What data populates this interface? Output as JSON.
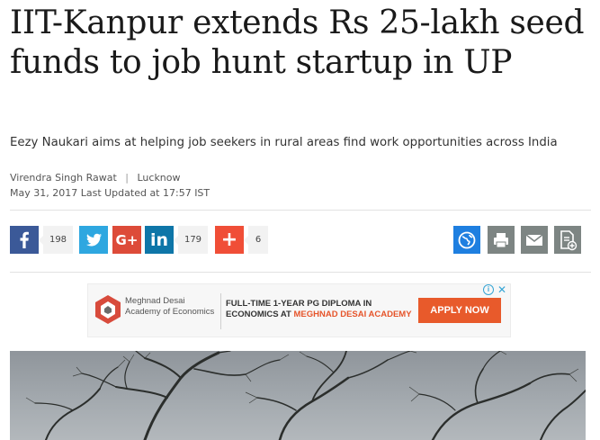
{
  "article": {
    "headline": "IIT-Kanpur extends Rs 25-lakh seed funds to job hunt startup in UP",
    "subhead": "Eezy Naukari aims at helping job seekers in rural areas find work opportunities across India",
    "author": "Virendra Singh Rawat",
    "separator": "|",
    "location": "Lucknow",
    "dateline": "May 31, 2017 Last Updated at 17:57 IST"
  },
  "share": {
    "facebook_icon": "facebook-icon",
    "facebook_count": "198",
    "twitter_icon": "twitter-icon",
    "googleplus_icon": "googleplus-icon",
    "googleplus_label": "G+",
    "linkedin_icon": "linkedin-icon",
    "linkedin_label": "in",
    "linkedin_count": "179",
    "more_icon": "plus-icon",
    "more_label": "+",
    "more_count": "6"
  },
  "tools": [
    "globe-icon",
    "print-icon",
    "email-icon",
    "add-document-icon"
  ],
  "ad": {
    "brand_line1": "Meghnad Desai",
    "brand_line2": "Academy of Economics",
    "copy_line1": "FULL-TIME 1-YEAR PG DIPLOMA IN",
    "copy_line2a": "ECONOMICS AT ",
    "copy_line2b": "MEGHNAD DESAI ACADEMY",
    "cta": "APPLY NOW",
    "info_label": "i",
    "close_label": "✕"
  },
  "colors": {
    "facebook": "#3b5998",
    "twitter": "#2ea7e0",
    "googleplus": "#dd4b39",
    "linkedin": "#0e76a8",
    "more": "#f04e37",
    "globe": "#1e7fe0",
    "tool_grey": "#7d8583",
    "ad_accent": "#e85a2b"
  }
}
